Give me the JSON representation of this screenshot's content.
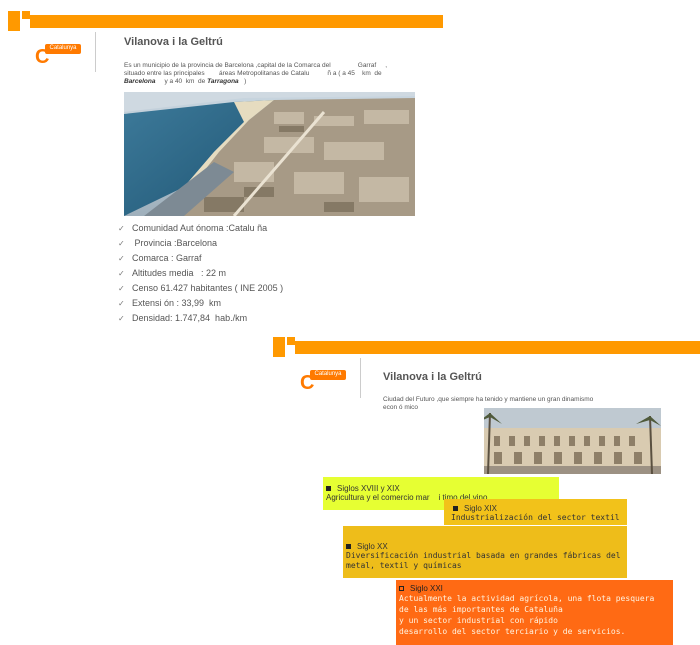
{
  "slide1": {
    "logo": {
      "text": "Catalunya",
      "letter": "C"
    },
    "title": "Vilanova i la Geltrú",
    "intro": {
      "line1": "Es un municipio de la provincia de Barcelona ,capital de la Comarca del               Garraf     ,",
      "line2": "situado entre las principales        áreas Metropolitanas de Catalu          ñ a ( a 45    km  de",
      "city1": "Barcelona",
      "mid": "     y a 40  km  de",
      "city2": "Tarragona",
      "end": "   )"
    },
    "photo_alt": "aerial-view-coast-town",
    "facts": [
      "Comunidad Aut ónoma :Catalu  ña",
      " Provincia :Barcelona",
      "Comarca : Garraf",
      "Altitudes media   : 22 m",
      "Censo 61.427 habitantes ( INE 2005 )",
      "Extensi ón : 33,99  km",
      "Densidad: 1.747,84  hab./km"
    ]
  },
  "slide2": {
    "logo": {
      "text": "Catalunya",
      "letter": "C"
    },
    "title": "Vilanova i la Geltrú",
    "intro": {
      "line1": "Ciudad del Futuro ,que siempre ha tenido y mantiene un gran dinamismo",
      "line2": "econ ó mico"
    },
    "photo_alt": "town-square-with-palms",
    "history": [
      {
        "heading": "Siglos XVIII y XIX",
        "text": "Agricultura y el comercio mar    i timo del vino",
        "color": "#e6ff33"
      },
      {
        "heading": "Siglo XIX",
        "text": "Industrialización del sector textil",
        "color": "#f2c21a"
      },
      {
        "heading": "Siglo XX",
        "text": "Diversificación industrial basada en grandes fábricas del metal, textil y químicas",
        "color": "#eebd1a"
      },
      {
        "heading": "Siglo XXI",
        "lines": [
          "Actualmente la actividad agrícola, una flota pesquera",
          "de las más importantes de Cataluña",
          "y un sector industrial con rápido",
          "desarrollo del sector terciario y de servicios."
        ],
        "color": "#ff6a14"
      }
    ]
  }
}
